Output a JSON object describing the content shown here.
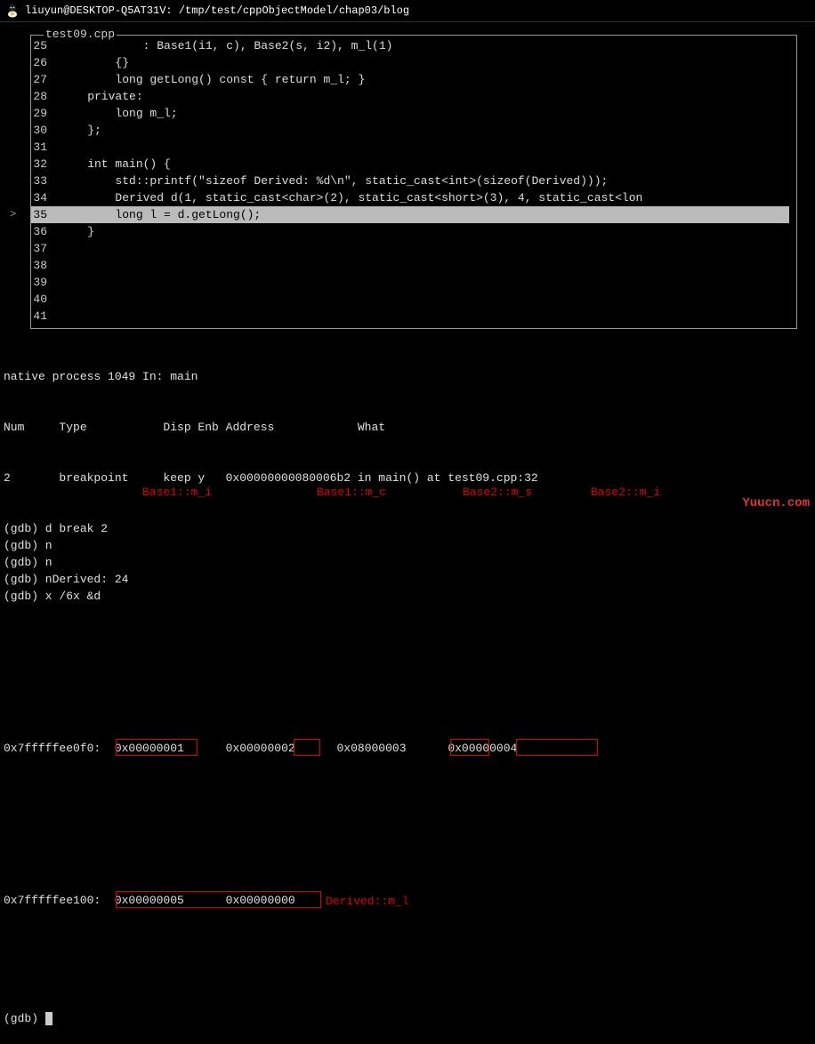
{
  "titlebar": {
    "text": "liuyun@DESKTOP-Q5AT31V: /tmp/test/cppObjectModel/chap03/blog"
  },
  "editor": {
    "filename": "test09.cpp",
    "lines": [
      {
        "num": "25",
        "text": "            : Base1(i1, c), Base2(s, i2), m_l(1)"
      },
      {
        "num": "26",
        "text": "        {}"
      },
      {
        "num": "27",
        "text": "        long getLong() const { return m_l; }"
      },
      {
        "num": "28",
        "text": "    private:"
      },
      {
        "num": "29",
        "text": "        long m_l;"
      },
      {
        "num": "30",
        "text": "    };"
      },
      {
        "num": "31",
        "text": ""
      },
      {
        "num": "32",
        "text": "    int main() {"
      },
      {
        "num": "33",
        "text": "        std::printf(\"sizeof Derived: %d\\n\", static_cast<int>(sizeof(Derived)));"
      },
      {
        "num": "34",
        "text": "        Derived d(1, static_cast<char>(2), static_cast<short>(3), 4, static_cast<lon"
      },
      {
        "num": "35",
        "text": "        long l = d.getLong();",
        "current": true
      },
      {
        "num": "36",
        "text": "    }"
      },
      {
        "num": "37",
        "text": ""
      },
      {
        "num": "38",
        "text": ""
      },
      {
        "num": "39",
        "text": ""
      },
      {
        "num": "40",
        "text": ""
      },
      {
        "num": "41",
        "text": ""
      }
    ]
  },
  "status_line": "native process 1049 In: main",
  "gdb": {
    "header": "Num     Type           Disp Enb Address            What",
    "breakpoint": "2       breakpoint     keep y   0x00000000080006b2 in main() at test09.cpp:32",
    "cmds": [
      "(gdb) d break 2",
      "(gdb) n",
      "(gdb) n",
      "(gdb) nDerived: 24",
      "(gdb) x /6x &d"
    ],
    "mem": [
      {
        "addr": "0x7fffffee0f0:",
        "v1": "0x00000001",
        "v2": "0x00000002",
        "v3": "0x08000003",
        "v4": "0x00000004"
      },
      {
        "addr": "0x7fffffee100:",
        "v1": "0x00000005",
        "v2": "0x00000000"
      }
    ],
    "prompt": "(gdb) "
  },
  "annotations": {
    "base1_mi": "Base1::m_i",
    "base1_mc": "Base1::m_c",
    "base2_ms": "Base2::m_s",
    "base2_mi": "Base2::m_i",
    "derived_ml": "Derived::m_l"
  },
  "watermark": "Yuucn.com"
}
